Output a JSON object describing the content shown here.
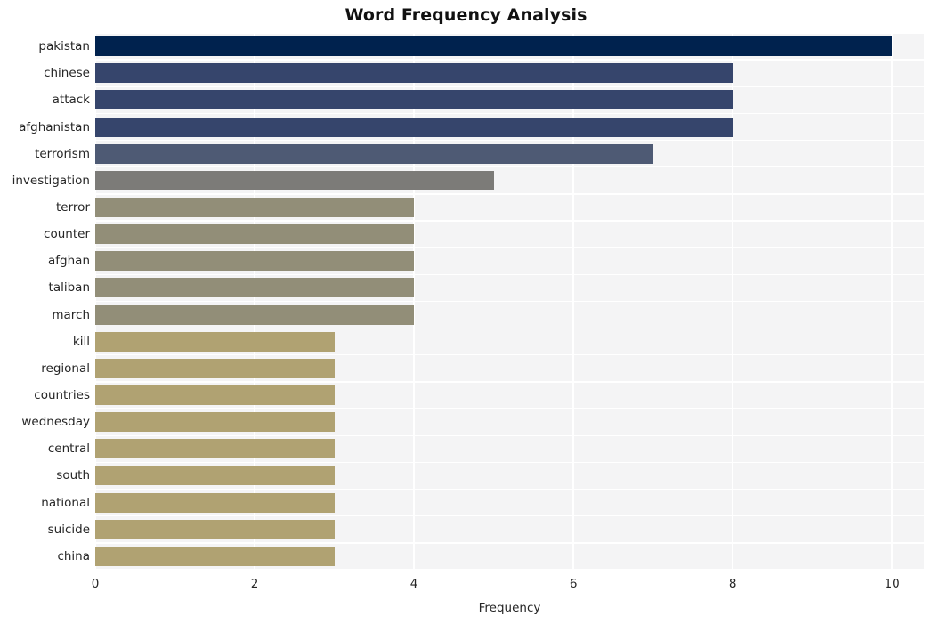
{
  "chart_data": {
    "type": "bar",
    "orientation": "horizontal",
    "title": "Word Frequency Analysis",
    "xlabel": "Frequency",
    "ylabel": "",
    "xlim": [
      0,
      10.4
    ],
    "xticks": [
      0,
      2,
      4,
      6,
      8,
      10
    ],
    "xtick_labels": [
      "0",
      "2",
      "4",
      "6",
      "8",
      "10"
    ],
    "grid": true,
    "legend": null,
    "categories": [
      "pakistan",
      "chinese",
      "attack",
      "afghanistan",
      "terrorism",
      "investigation",
      "terror",
      "counter",
      "afghan",
      "taliban",
      "march",
      "kill",
      "regional",
      "countries",
      "wednesday",
      "central",
      "south",
      "national",
      "suicide",
      "china"
    ],
    "values": [
      10,
      8,
      8,
      8,
      7,
      5,
      4,
      4,
      4,
      4,
      4,
      3,
      3,
      3,
      3,
      3,
      3,
      3,
      3,
      3
    ],
    "bar_colors": [
      "#00224e",
      "#36456c",
      "#36456c",
      "#36456c",
      "#4e5a74",
      "#7c7b78",
      "#928e78",
      "#928e78",
      "#928e78",
      "#928e78",
      "#928e78",
      "#b0a272",
      "#b0a272",
      "#b0a272",
      "#b0a272",
      "#b0a272",
      "#b0a272",
      "#b0a272",
      "#b0a272",
      "#b0a272"
    ],
    "colormap": "cividis",
    "plot_background": "#f4f4f5",
    "grid_color": "#ffffff",
    "figure_background": "#ffffff",
    "text_color": "#262626"
  }
}
